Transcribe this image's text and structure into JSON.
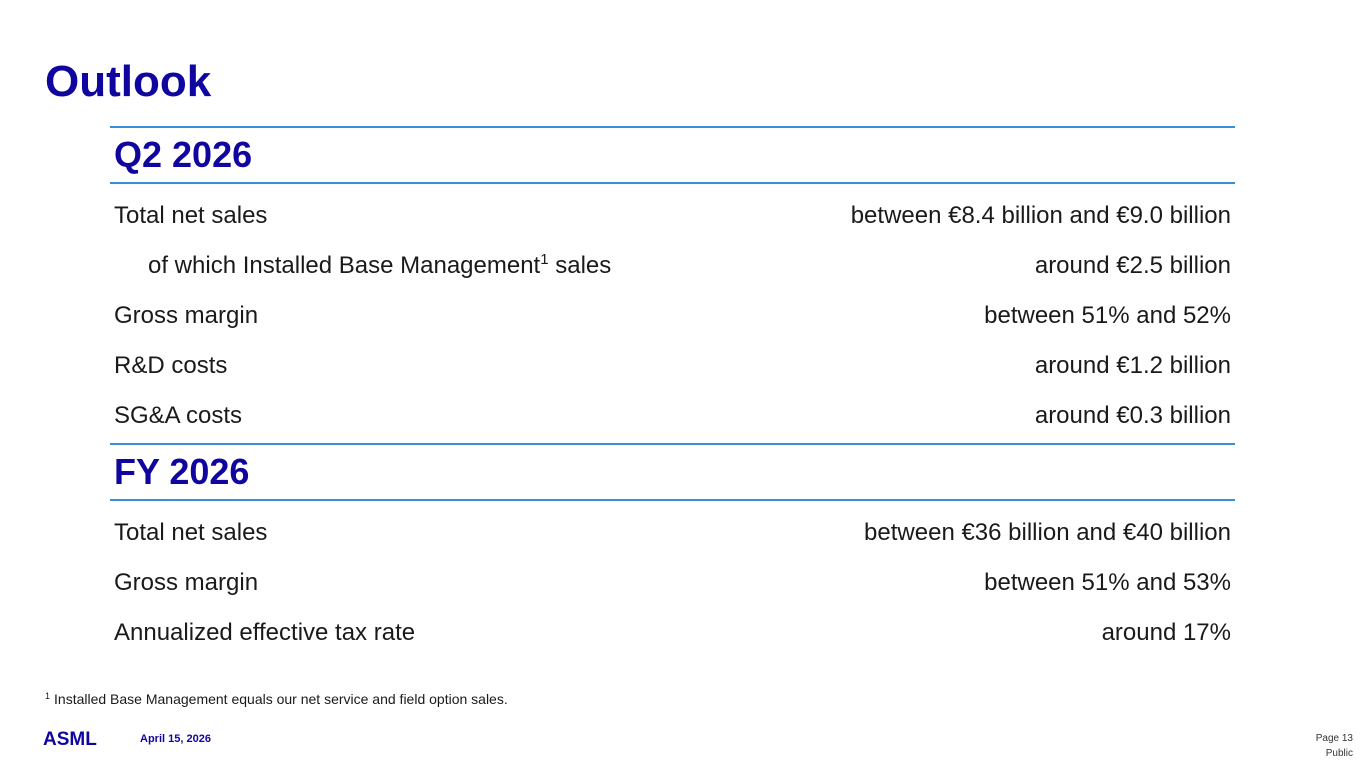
{
  "slide": {
    "title": "Outlook"
  },
  "q2": {
    "heading": "Q2 2026",
    "rows": [
      {
        "label": "Total net sales",
        "value": "between €8.4 billion and €9.0 billion"
      },
      {
        "label_pre": "of which Installed Base Management",
        "label_sup": "1",
        "label_post": " sales",
        "value": "around €2.5 billion"
      },
      {
        "label": "Gross margin",
        "value": "between 51% and 52%"
      },
      {
        "label": "R&D costs",
        "value": "around €1.2 billion"
      },
      {
        "label": "SG&A costs",
        "value": "around €0.3 billion"
      }
    ]
  },
  "fy": {
    "heading": "FY 2026",
    "rows": [
      {
        "label": "Total net sales",
        "value": "between €36 billion and €40 billion"
      },
      {
        "label": "Gross margin",
        "value": "between 51% and 53%"
      },
      {
        "label": "Annualized effective tax rate",
        "value": "around 17%"
      }
    ]
  },
  "footnote": {
    "marker": "1",
    "text": "Installed Base Management equals our net service and field option sales."
  },
  "footer": {
    "logo_text": "ASML",
    "date": "April 15, 2026",
    "page": "Page 13",
    "classification": "Public"
  },
  "colors": {
    "brand": "#10069f",
    "rule": "#3a8fd6",
    "text": "#1a1a1a"
  }
}
